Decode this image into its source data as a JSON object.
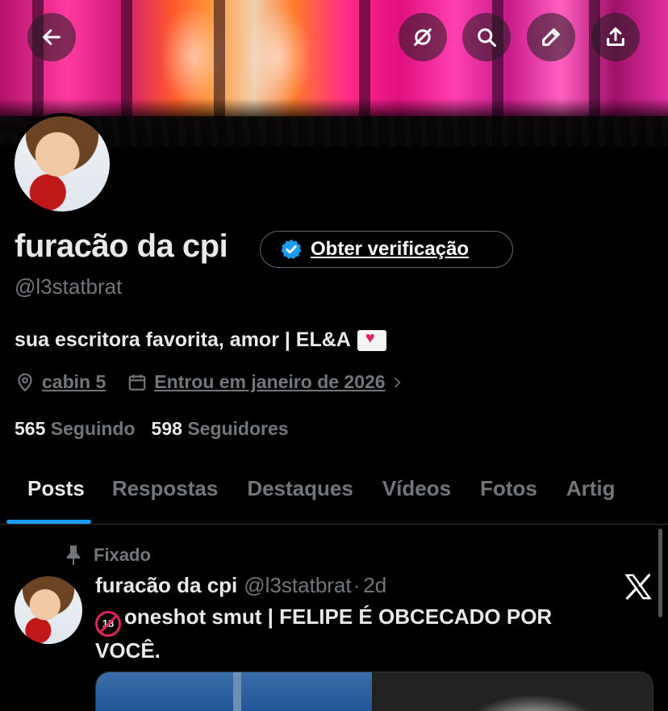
{
  "profile": {
    "name": "furacão da cpi",
    "handle": "@l3statbrat",
    "verify_label": "Obter verificação",
    "bio": "sua escritora favorita, amor | EL&A",
    "location": "cabin 5",
    "joined": "Entrou em janeiro de 2026",
    "following_count": "565",
    "following_label": "Seguindo",
    "followers_count": "598",
    "followers_label": "Seguidores"
  },
  "tabs": [
    {
      "label": "Posts",
      "active": true
    },
    {
      "label": "Respostas",
      "active": false
    },
    {
      "label": "Destaques",
      "active": false
    },
    {
      "label": "Vídeos",
      "active": false
    },
    {
      "label": "Fotos",
      "active": false
    },
    {
      "label": "Artig",
      "active": false
    }
  ],
  "post": {
    "pinned_label": "Fixado",
    "author_name": "furacão da cpi",
    "author_handle": "@l3statbrat",
    "separator": "·",
    "age": "2d",
    "text": "oneshot smut | FELIPE É OBCECADO POR VOCÊ."
  },
  "icons": {
    "back": "arrow-left-icon",
    "circle_slash": "circle-slash-icon",
    "search": "search-icon",
    "edit": "pencil-icon",
    "share": "share-icon",
    "location": "location-pin-icon",
    "calendar": "calendar-icon",
    "pin": "pin-icon",
    "x_logo": "x-logo-icon"
  },
  "colors": {
    "accent": "#1d9bf0",
    "muted": "#71767b",
    "text": "#e7e9ea",
    "background": "#000000"
  }
}
